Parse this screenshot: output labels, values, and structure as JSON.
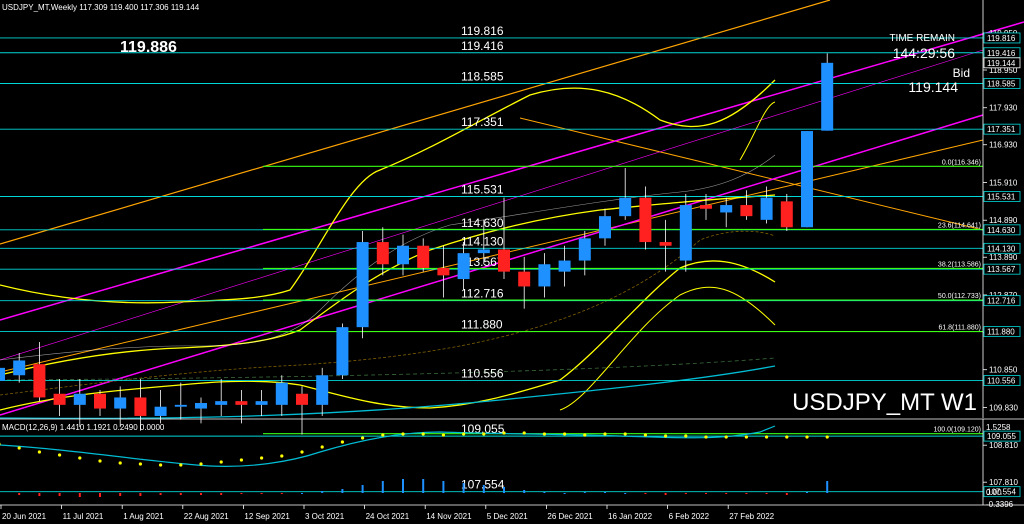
{
  "header": {
    "symbol_info": "USDJPY_MT,Weekly  117.309 119.400 117.306 119.144",
    "big_price": "119.886",
    "watermark": "USDJPY_MT W1"
  },
  "info_box": {
    "time_remain_label": "TIME REMAIN",
    "time_remain_value": "144:29:56",
    "bid_label": "Bid",
    "bid_value": "119.144"
  },
  "level_labels": [
    {
      "text": "119.816",
      "price": 119.816
    },
    {
      "text": "119.416",
      "price": 119.416
    },
    {
      "text": "118.585",
      "price": 118.585
    },
    {
      "text": "117.351",
      "price": 117.351
    },
    {
      "text": "115.531",
      "price": 115.531
    },
    {
      "text": "114.630",
      "price": 114.63
    },
    {
      "text": "114.130",
      "price": 114.13
    },
    {
      "text": "113.567",
      "price": 113.567
    },
    {
      "text": "112.716",
      "price": 112.716
    },
    {
      "text": "111.880",
      "price": 111.88
    },
    {
      "text": "110.556",
      "price": 110.556
    },
    {
      "text": "109.055",
      "price": 109.055
    },
    {
      "text": "107.554",
      "price": 107.554
    }
  ],
  "fib_labels": [
    {
      "text": "0.0(116.346)",
      "price": 116.346
    },
    {
      "text": "23.6(114.641)",
      "price": 114.641
    },
    {
      "text": "38.2(113.586)",
      "price": 113.586
    },
    {
      "text": "50.0(112.733)",
      "price": 112.733
    },
    {
      "text": "61.8(111.880)",
      "price": 111.88
    },
    {
      "text": "100.0(109.120)",
      "price": 109.12
    }
  ],
  "price_axis": {
    "grey_ticks": [
      "119.950",
      "118.950",
      "117.930",
      "116.930",
      "115.910",
      "114.890",
      "113.890",
      "112.870",
      "111.850",
      "110.850",
      "109.830",
      "108.810",
      "107.810"
    ],
    "grey_tick_prices": [
      119.95,
      118.95,
      117.93,
      116.93,
      115.91,
      114.89,
      113.89,
      112.87,
      111.85,
      110.85,
      109.83,
      108.81,
      107.81
    ],
    "boxed": [
      "119.816",
      "119.416",
      "119.144",
      "118.585",
      "117.351",
      "115.531",
      "114.630",
      "114.130",
      "113.567",
      "112.716",
      "111.880",
      "110.556",
      "109.055",
      "107.554"
    ],
    "boxed_prices": [
      119.816,
      119.416,
      119.144,
      118.585,
      117.351,
      115.531,
      114.63,
      114.13,
      113.567,
      112.716,
      111.88,
      110.556,
      109.055,
      107.554
    ]
  },
  "date_axis": [
    "20 Jun 2021",
    "11 Jul 2021",
    "1 Aug 2021",
    "22 Aug 2021",
    "12 Sep 2021",
    "3 Oct 2021",
    "24 Oct 2021",
    "14 Nov 2021",
    "5 Dec 2021",
    "26 Dec 2021",
    "16 Jan 2022",
    "6 Feb 2022",
    "27 Feb 2022"
  ],
  "macd": {
    "label": "MACD(12,26,9) 1.4410 1.1921 0.2490 0.0000",
    "axis_top": "1.5258",
    "axis_zero": "0.00",
    "axis_bottom": "-0.3396"
  },
  "colors": {
    "bull": "#1e90ff",
    "bear": "#ff2020",
    "level_line": "#00d8d8",
    "fib_line": "#39ff14",
    "channel": "#ff00ff",
    "bands": "#ffff00",
    "orange": "#ffa500"
  },
  "chart_data": {
    "type": "candlestick",
    "title": "USDJPY_MT,Weekly",
    "ylim": [
      107.5,
      120.05
    ],
    "candles": [
      {
        "o": 110.55,
        "h": 110.9,
        "l": 110.0,
        "c": 110.9
      },
      {
        "o": 110.7,
        "h": 111.3,
        "l": 110.5,
        "c": 111.1
      },
      {
        "o": 111.0,
        "h": 111.6,
        "l": 110.0,
        "c": 110.1
      },
      {
        "o": 110.2,
        "h": 110.6,
        "l": 109.6,
        "c": 109.9
      },
      {
        "o": 109.9,
        "h": 110.6,
        "l": 109.3,
        "c": 110.2
      },
      {
        "o": 110.2,
        "h": 110.3,
        "l": 109.6,
        "c": 109.8
      },
      {
        "o": 109.8,
        "h": 110.4,
        "l": 109.3,
        "c": 110.1
      },
      {
        "o": 110.1,
        "h": 110.6,
        "l": 109.2,
        "c": 109.6
      },
      {
        "o": 109.6,
        "h": 110.3,
        "l": 109.4,
        "c": 109.85
      },
      {
        "o": 109.85,
        "h": 110.5,
        "l": 109.5,
        "c": 109.9
      },
      {
        "o": 109.8,
        "h": 110.1,
        "l": 109.4,
        "c": 109.95
      },
      {
        "o": 109.9,
        "h": 110.6,
        "l": 109.6,
        "c": 110.0
      },
      {
        "o": 110.0,
        "h": 110.3,
        "l": 109.4,
        "c": 109.9
      },
      {
        "o": 109.9,
        "h": 110.3,
        "l": 109.6,
        "c": 110.0
      },
      {
        "o": 109.9,
        "h": 110.7,
        "l": 109.6,
        "c": 110.5
      },
      {
        "o": 110.2,
        "h": 110.4,
        "l": 109.1,
        "c": 109.9
      },
      {
        "o": 109.9,
        "h": 110.9,
        "l": 109.6,
        "c": 110.7
      },
      {
        "o": 110.7,
        "h": 112.1,
        "l": 110.6,
        "c": 112.0
      },
      {
        "o": 112.0,
        "h": 114.6,
        "l": 111.7,
        "c": 114.3
      },
      {
        "o": 114.3,
        "h": 114.7,
        "l": 113.4,
        "c": 113.7
      },
      {
        "o": 113.7,
        "h": 114.5,
        "l": 113.4,
        "c": 114.2
      },
      {
        "o": 114.2,
        "h": 114.4,
        "l": 113.5,
        "c": 113.6
      },
      {
        "o": 113.6,
        "h": 114.2,
        "l": 112.8,
        "c": 113.4
      },
      {
        "o": 113.3,
        "h": 114.3,
        "l": 113.0,
        "c": 114.0
      },
      {
        "o": 114.0,
        "h": 114.9,
        "l": 113.7,
        "c": 114.1
      },
      {
        "o": 114.1,
        "h": 115.5,
        "l": 113.3,
        "c": 113.5
      },
      {
        "o": 113.5,
        "h": 113.9,
        "l": 112.5,
        "c": 113.1
      },
      {
        "o": 113.1,
        "h": 114.0,
        "l": 112.8,
        "c": 113.7
      },
      {
        "o": 113.5,
        "h": 114.2,
        "l": 113.1,
        "c": 113.8
      },
      {
        "o": 113.8,
        "h": 114.6,
        "l": 113.4,
        "c": 114.4
      },
      {
        "o": 114.4,
        "h": 115.2,
        "l": 114.2,
        "c": 115.0
      },
      {
        "o": 115.0,
        "h": 116.3,
        "l": 114.9,
        "c": 115.5
      },
      {
        "o": 115.5,
        "h": 115.8,
        "l": 114.1,
        "c": 114.3
      },
      {
        "o": 114.3,
        "h": 114.9,
        "l": 113.5,
        "c": 114.2
      },
      {
        "o": 113.8,
        "h": 115.6,
        "l": 113.5,
        "c": 115.3
      },
      {
        "o": 115.3,
        "h": 115.6,
        "l": 114.9,
        "c": 115.2
      },
      {
        "o": 115.1,
        "h": 115.5,
        "l": 114.7,
        "c": 115.3
      },
      {
        "o": 115.3,
        "h": 115.7,
        "l": 114.9,
        "c": 115.0
      },
      {
        "o": 114.9,
        "h": 115.8,
        "l": 114.8,
        "c": 115.5
      },
      {
        "o": 115.4,
        "h": 115.6,
        "l": 114.6,
        "c": 114.7
      },
      {
        "o": 114.7,
        "h": 117.3,
        "l": 114.7,
        "c": 117.3
      },
      {
        "o": 117.31,
        "h": 119.4,
        "l": 117.31,
        "c": 119.144
      }
    ]
  }
}
